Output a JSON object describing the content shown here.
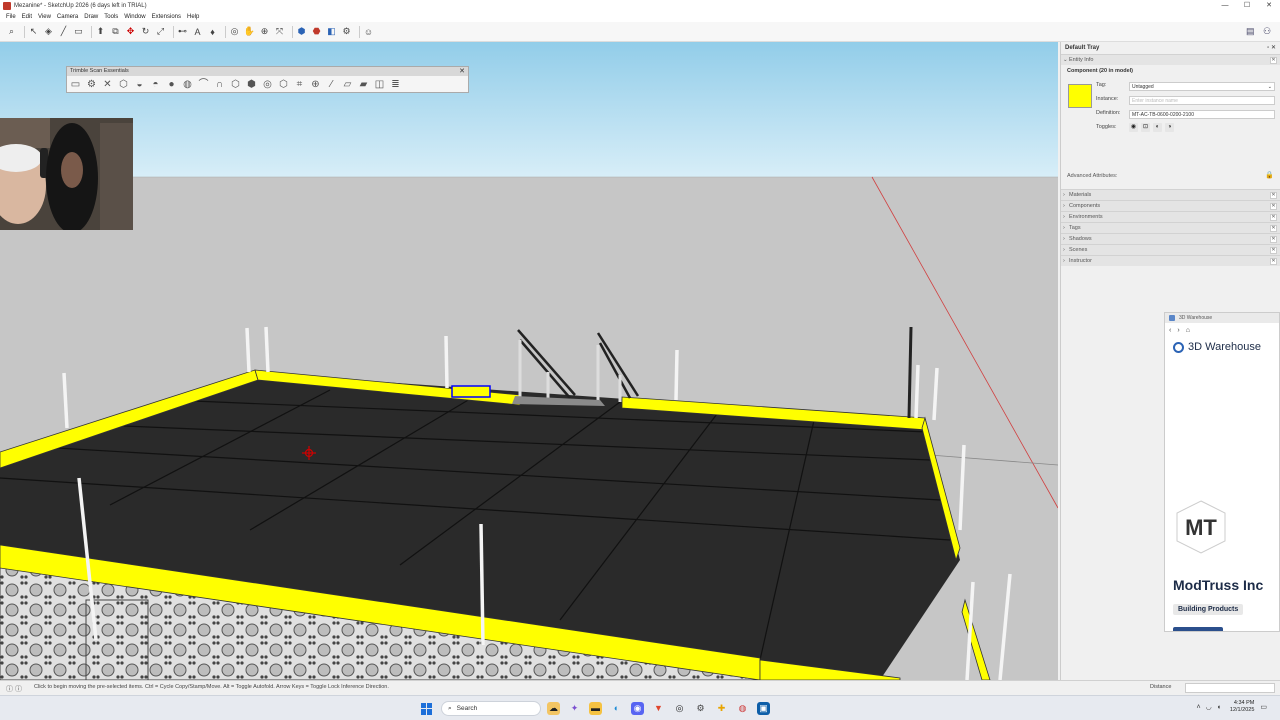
{
  "window": {
    "title": "Mezanine* - SketchUp 2026 (6 days left in TRIAL)",
    "controls": [
      "—",
      "☐",
      "✕"
    ]
  },
  "menu": [
    "File",
    "Edit",
    "View",
    "Camera",
    "Draw",
    "Tools",
    "Window",
    "Extensions",
    "Help"
  ],
  "trimble_palette": {
    "title": "Trimble Scan Essentials",
    "close": "✕"
  },
  "tray": {
    "title": "Default Tray",
    "entity_info": {
      "header": "Entity Info",
      "component": "Component (20 in model)",
      "color": "#ffff00",
      "tag_label": "Tag:",
      "tag_value": "Untagged",
      "instance_label": "Instance:",
      "instance_placeholder": "Enter instance name",
      "definition_label": "Definition:",
      "definition_value": "MT-AC-TB-0600-0200-2100",
      "toggles_label": "Toggles:",
      "advanced_label": "Advanced Attributes:"
    },
    "panels": [
      "Materials",
      "Components",
      "Environments",
      "Tags",
      "Shadows",
      "Scenes",
      "Instructor"
    ]
  },
  "warehouse": {
    "window_title": "3D Warehouse",
    "brand": "3D Warehouse",
    "logo_text": "MT",
    "company": "ModTruss Inc",
    "tag": "Building Products"
  },
  "status": {
    "text": "Click to begin moving the pre-selected items. Ctrl = Cycle Copy/Stamp/Move. Alt = Toggle Autofold. Arrow Keys = Toggle Lock Inference Direction.",
    "measure_label": "Distance"
  },
  "taskbar": {
    "search": "Search",
    "time": "4:34 PM",
    "date": "12/1/2025"
  },
  "colors": {
    "sky": "#a9d8ef",
    "ground": "#c6c6c6",
    "deck": "#2b2b2b",
    "rail": "#ffff00",
    "selection": "#0000ff"
  }
}
